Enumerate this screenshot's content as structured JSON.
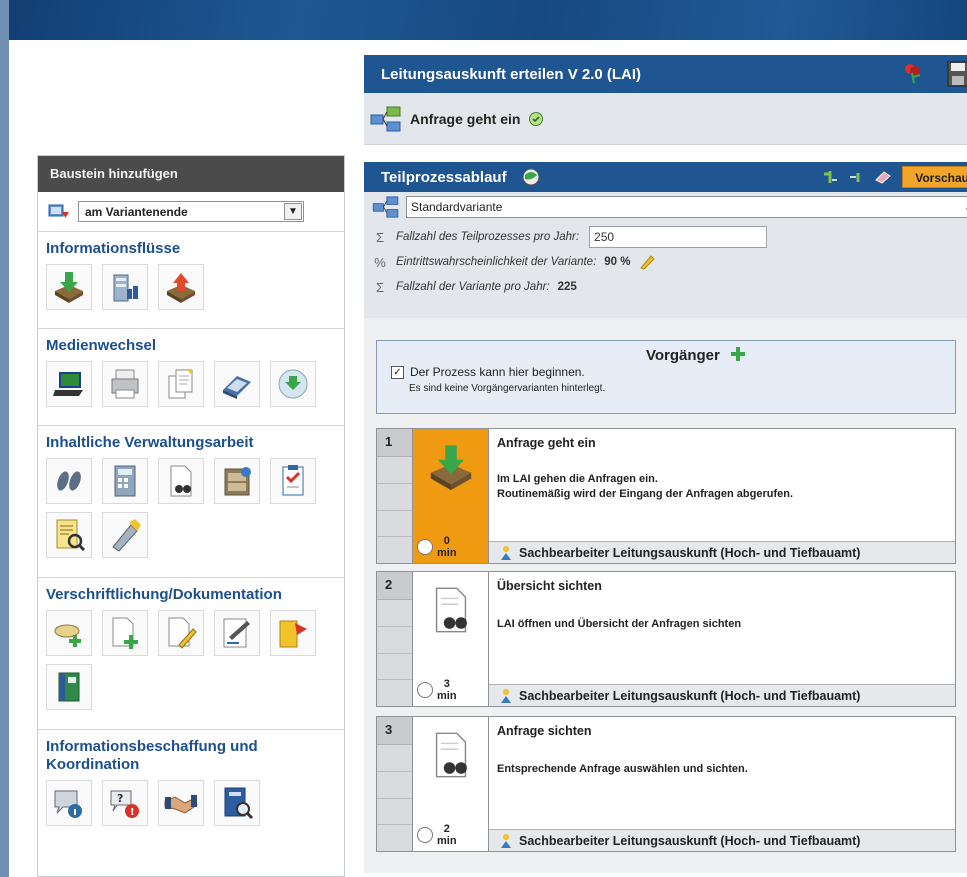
{
  "app": {
    "title": "Leitungsauskunft erteilen V 2.0 (LAI)",
    "subtitle": "Anfrage geht ein"
  },
  "sidebar": {
    "header": "Baustein hinzufügen",
    "position_select": "am Variantenende",
    "categories": [
      {
        "title": "Informationsflüsse",
        "icons": [
          "inbox-download-icon",
          "archive-bin-icon",
          "outbox-upload-icon"
        ]
      },
      {
        "title": "Medienwechsel",
        "icons": [
          "laptop-icon",
          "printer-icon",
          "document-copy-icon",
          "scanner-icon",
          "cd-icon"
        ]
      },
      {
        "title": "Inhaltliche Verwaltungsarbeit",
        "icons": [
          "footsteps-icon",
          "calculator-icon",
          "document-binoculars-icon",
          "cabinet-icon",
          "checklist-icon",
          "document-search-icon",
          "pen-tool-icon"
        ]
      },
      {
        "title": "Verschriftlichung/Dokumentation",
        "icons": [
          "disk-add-icon",
          "document-add-icon",
          "document-edit-icon",
          "sign-document-icon",
          "folder-pin-icon",
          "binder-icon"
        ]
      },
      {
        "title": "Informationsbeschaffung und Koordination",
        "icons": [
          "chat-info-icon",
          "question-icon",
          "handshake-icon",
          "book-search-icon"
        ]
      }
    ]
  },
  "toolbar": {
    "tab_label": "Teilprozessablauf",
    "preview_label": "Vorschau"
  },
  "variant": {
    "select_value": "Standardvariante",
    "fallzahl_label": "Fallzahl des Teilprozesses pro Jahr:",
    "fallzahl_value": "250",
    "prob_label": "Eintrittswahrscheinlichkeit der Variante:",
    "prob_value": "90 %",
    "var_count_label": "Fallzahl der Variante pro Jahr:",
    "var_count_value": "225"
  },
  "predecessor": {
    "title": "Vorgänger",
    "checkbox_label": "Der Prozess kann hier beginnen.",
    "note": "Es sind keine Vorgängervarianten hinterlegt."
  },
  "steps": [
    {
      "num": "1",
      "title": "Anfrage geht ein",
      "desc1": "Im LAI gehen die Anfragen ein.",
      "desc2": "Routinemäßig wird der Eingang der Anfragen abgerufen.",
      "time": "0",
      "unit": "min",
      "role": "Sachbearbeiter Leitungsauskunft (Hoch- und Tiefbauamt)"
    },
    {
      "num": "2",
      "title": "Übersicht sichten",
      "desc1": "LAI öffnen und Übersicht der Anfragen sichten",
      "time": "3",
      "unit": "min",
      "role": "Sachbearbeiter Leitungsauskunft (Hoch- und Tiefbauamt)"
    },
    {
      "num": "3",
      "title": "Anfrage sichten",
      "desc1": "Entsprechende Anfrage auswählen und sichten.",
      "time": "2",
      "unit": "min",
      "role": "Sachbearbeiter Leitungsauskunft (Hoch- und Tiefbauamt)"
    }
  ],
  "colors": {
    "brand_blue": "#1f5590",
    "accent_orange": "#f09a12",
    "category_title": "#1c4f8c"
  }
}
